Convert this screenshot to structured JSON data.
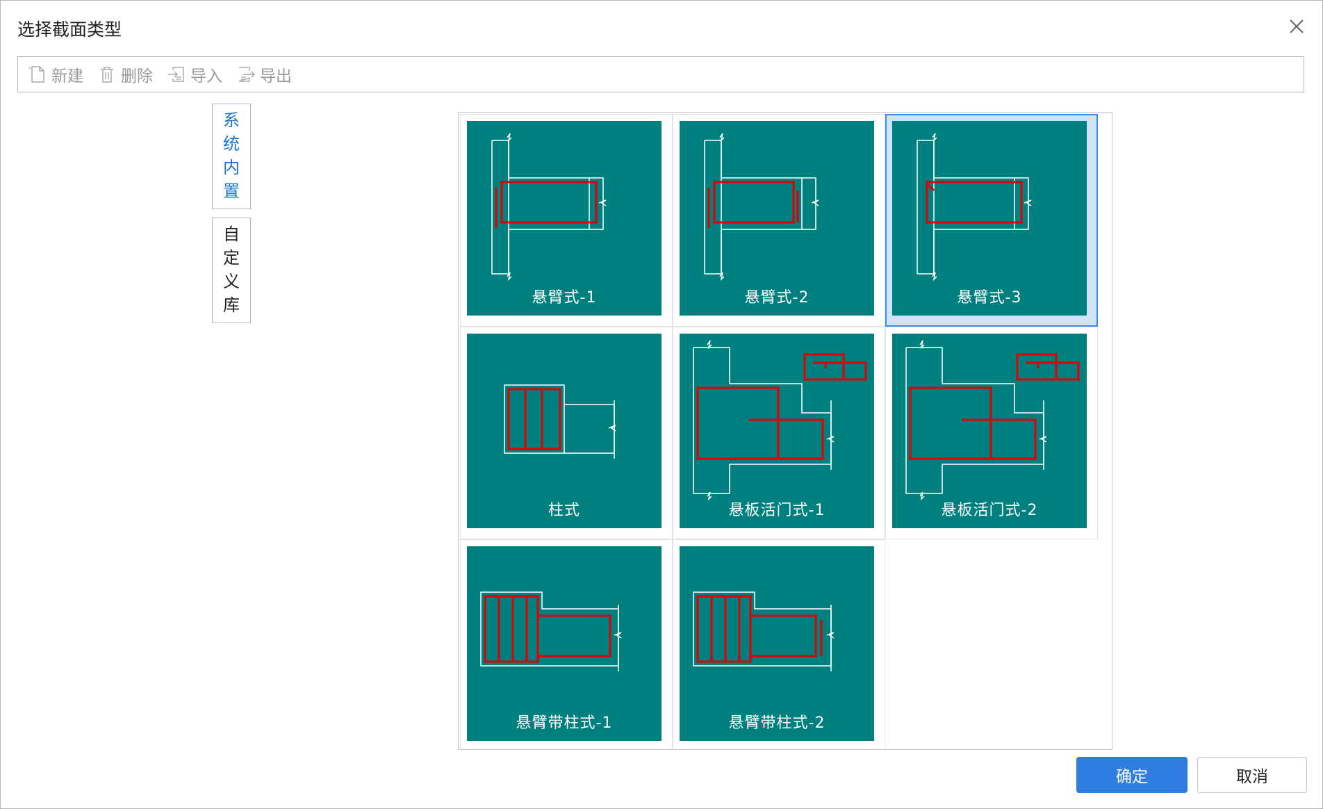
{
  "dialog": {
    "title": "选择截面类型",
    "close_icon": "close-icon"
  },
  "toolbar": {
    "new_label": "新建",
    "delete_label": "删除",
    "import_label": "导入",
    "export_label": "导出"
  },
  "side_tabs": [
    {
      "chars": [
        "系",
        "统",
        "内",
        "置"
      ],
      "active": true
    },
    {
      "chars": [
        "自",
        "定",
        "义",
        "库"
      ],
      "active": false
    }
  ],
  "sections": [
    {
      "label": "悬臂式-1",
      "selected": false
    },
    {
      "label": "悬臂式-2",
      "selected": false
    },
    {
      "label": "悬臂式-3",
      "selected": true
    },
    {
      "label": "柱式",
      "selected": false
    },
    {
      "label": "悬板活门式-1",
      "selected": false
    },
    {
      "label": "悬板活门式-2",
      "selected": false
    },
    {
      "label": "悬臂带柱式-1",
      "selected": false
    },
    {
      "label": "悬臂带柱式-2",
      "selected": false
    }
  ],
  "buttons": {
    "ok_label": "确定",
    "cancel_label": "取消"
  },
  "colors": {
    "tile_bg": "#007f7f",
    "rebar": "#e00000",
    "outline": "#ffffff",
    "accent": "#2f7de1"
  }
}
